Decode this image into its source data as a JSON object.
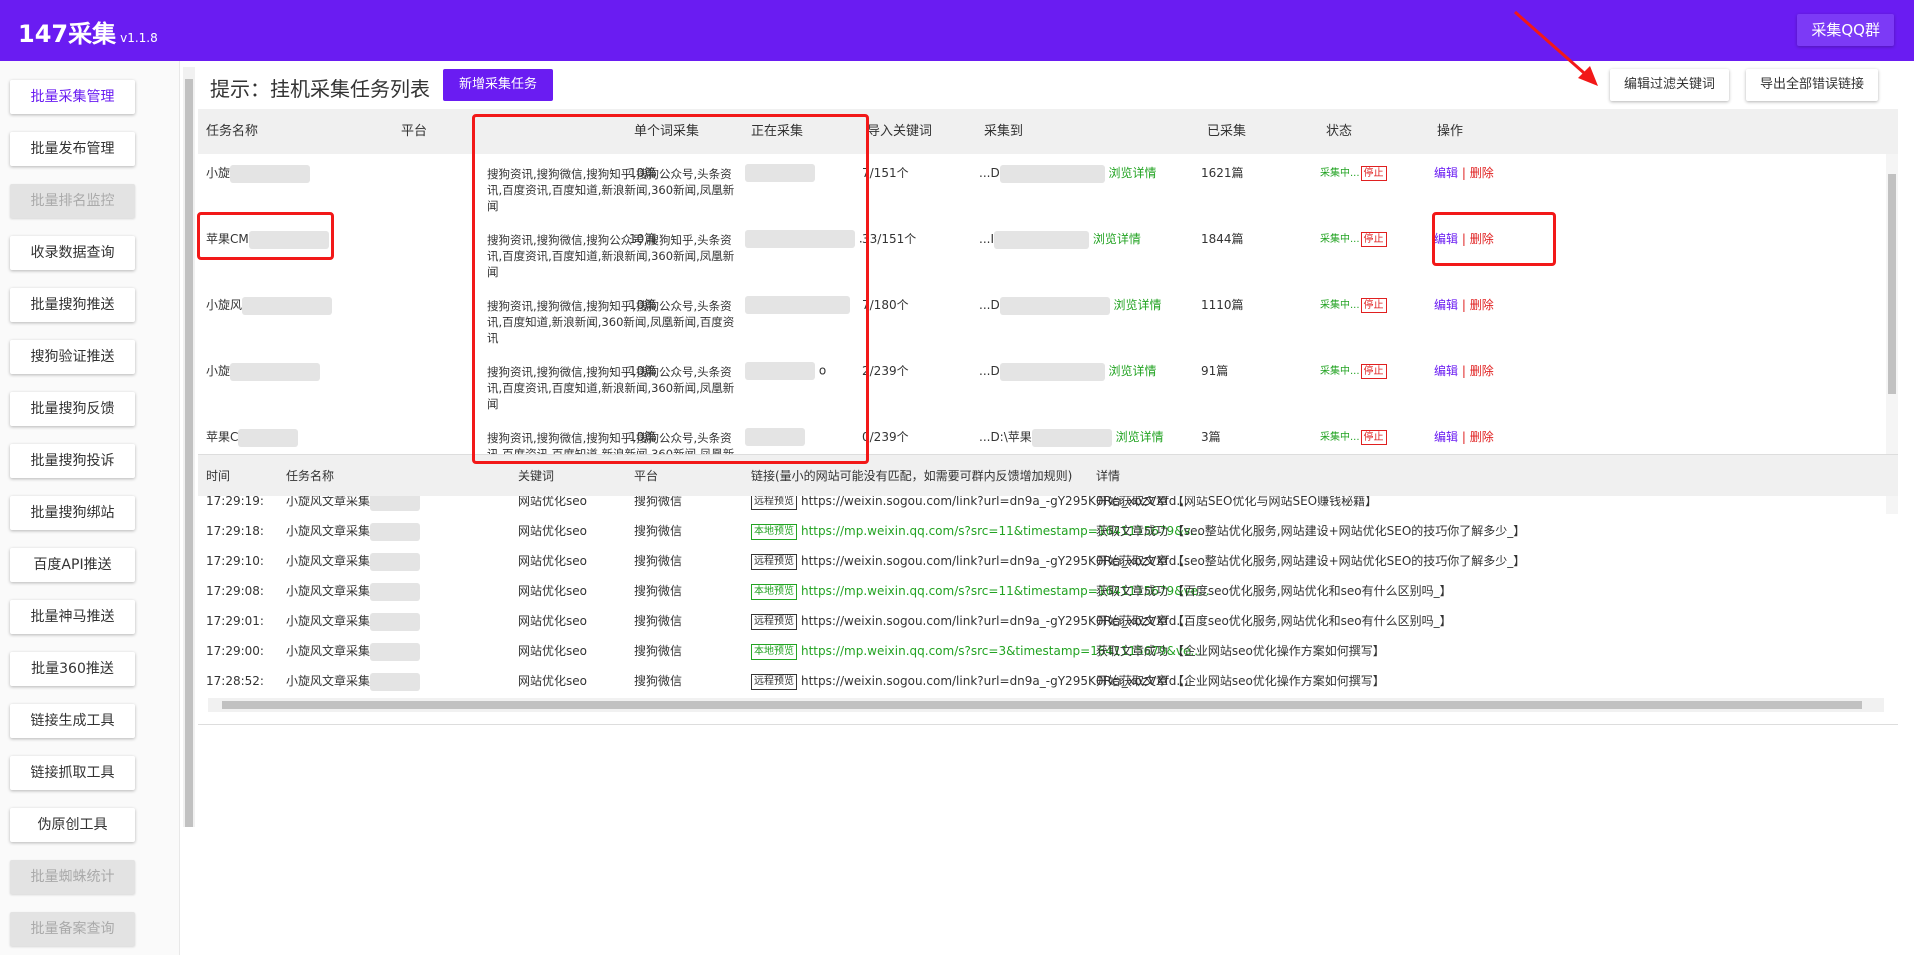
{
  "app": {
    "title": "147采集",
    "version": "v1.1.8",
    "qq_button": "采集QQ群"
  },
  "sidebar": {
    "items": [
      {
        "label": "批量采集管理",
        "state": "active"
      },
      {
        "label": "批量发布管理",
        "state": "normal"
      },
      {
        "label": "批量排名监控",
        "state": "disabled"
      },
      {
        "label": "收录数据查询",
        "state": "normal"
      },
      {
        "label": "批量搜狗推送",
        "state": "normal"
      },
      {
        "label": "搜狗验证推送",
        "state": "normal"
      },
      {
        "label": "批量搜狗反馈",
        "state": "normal"
      },
      {
        "label": "批量搜狗投诉",
        "state": "normal"
      },
      {
        "label": "批量搜狗绑站",
        "state": "normal"
      },
      {
        "label": "百度API推送",
        "state": "normal"
      },
      {
        "label": "批量神马推送",
        "state": "normal"
      },
      {
        "label": "批量360推送",
        "state": "normal"
      },
      {
        "label": "链接生成工具",
        "state": "normal"
      },
      {
        "label": "链接抓取工具",
        "state": "normal"
      },
      {
        "label": "伪原创工具",
        "state": "normal"
      },
      {
        "label": "批量蜘蛛统计",
        "state": "disabled"
      },
      {
        "label": "批量备案查询",
        "state": "disabled"
      }
    ]
  },
  "toolbar": {
    "hint": "提示：挂机采集任务列表",
    "new_task": "新增采集任务",
    "edit_filter": "编辑过滤关键词",
    "export_errors": "导出全部错误链接"
  },
  "task_table": {
    "columns": [
      "任务名称",
      "平台",
      "单个词采集",
      "正在采集",
      "导入关键词",
      "采集到",
      "已采集",
      "状态",
      "操作"
    ],
    "rows": [
      {
        "name": "小旋",
        "platforms": "搜狗资讯,搜狗微信,搜狗知乎,搜狗公众号,头条资讯,百度资讯,百度知道,新浪新闻,360新闻,凤凰新闻",
        "per_keyword": "10篇",
        "current": "",
        "keywords": "7/151个",
        "target": "...D",
        "detail": "浏览详情",
        "collected": "1621篇",
        "status": "采集中...",
        "stop": "停止",
        "edit": "编辑",
        "sep": "|",
        "delete": "删除"
      },
      {
        "name": "苹果CM",
        "platforms": "搜狗资讯,搜狗微信,搜狗公众号,搜狗知乎,头条资讯,百度资讯,百度知道,新浪新闻,360新闻,凤凰新闻",
        "per_keyword": "10篇",
        "current": ".",
        "keywords": "33/151个",
        "target": "...I",
        "detail": "浏览详情",
        "collected": "1844篇",
        "status": "采集中...",
        "stop": "停止",
        "edit": "编辑",
        "sep": "|",
        "delete": "删除"
      },
      {
        "name": "小旋风",
        "platforms": "搜狗资讯,搜狗微信,搜狗知乎,搜狗公众号,头条资讯,百度知道,新浪新闻,360新闻,凤凰新闻,百度资讯",
        "per_keyword": "10篇",
        "current": "",
        "keywords": "7/180个",
        "target": "...D",
        "detail": "浏览详情",
        "collected": "1110篇",
        "status": "采集中...",
        "stop": "停止",
        "edit": "编辑",
        "sep": "|",
        "delete": "删除"
      },
      {
        "name": "小旋",
        "platforms": "搜狗资讯,搜狗微信,搜狗知乎,搜狗公众号,头条资讯,百度资讯,百度知道,新浪新闻,360新闻,凤凰新闻",
        "per_keyword": "10篇",
        "current": "o",
        "keywords": "2/239个",
        "target": "...D",
        "detail": "浏览详情",
        "collected": "91篇",
        "status": "采集中...",
        "stop": "停止",
        "edit": "编辑",
        "sep": "|",
        "delete": "删除"
      },
      {
        "name": "苹果C",
        "platforms": "搜狗资讯,搜狗微信,搜狗知乎,搜狗公众号,头条资讯,百度资讯,百度知道,新浪新闻,360新闻,凤凰新闻",
        "per_keyword": "10篇",
        "current": "",
        "keywords": "0/239个",
        "target": "...D:\\苹果",
        "detail": "浏览详情",
        "collected": "3篇",
        "status": "采集中...",
        "stop": "停止",
        "edit": "编辑",
        "sep": "|",
        "delete": "删除"
      }
    ]
  },
  "log_table": {
    "columns": [
      "时间",
      "任务名称",
      "关键词",
      "平台",
      "链接(量小的网站可能没有匹配，如需要可群内反馈增加规则)",
      "详情"
    ],
    "rows": [
      {
        "time": "17:29:19:",
        "task": "小旋风文章采集",
        "keyword": "网站优化seo",
        "platform": "搜狗微信",
        "tag": "远程预览",
        "tag_type": "remote",
        "link": "https://weixin.sogou.com/link?url=dn9a_-gY295K0Rci_xozVXfd...",
        "detail": "开始获取文章 【网站SEO优化与网站SEO赚钱秘籍】"
      },
      {
        "time": "17:29:18:",
        "task": "小旋风文章采集",
        "keyword": "网站优化seo",
        "platform": "搜狗微信",
        "tag": "本地预览",
        "tag_type": "local",
        "link": "https://mp.weixin.qq.com/s?src=11&timestamp=1641115679&v...",
        "detail": "获取文章成功 【seo整站优化服务,网站建设+网站优化SEO的技巧你了解多少_】"
      },
      {
        "time": "17:29:10:",
        "task": "小旋风文章采集",
        "keyword": "网站优化seo",
        "platform": "搜狗微信",
        "tag": "远程预览",
        "tag_type": "remote",
        "link": "https://weixin.sogou.com/link?url=dn9a_-gY295K0Rci_xozVXfd...",
        "detail": "开始获取文章 【seo整站优化服务,网站建设+网站优化SEO的技巧你了解多少_】"
      },
      {
        "time": "17:29:08:",
        "task": "小旋风文章采集",
        "keyword": "网站优化seo",
        "platform": "搜狗微信",
        "tag": "本地预览",
        "tag_type": "local",
        "link": "https://mp.weixin.qq.com/s?src=11&timestamp=1641115679&ve...",
        "detail": "获取文章成功 【百度seo优化服务,网站优化和seo有什么区别吗_】"
      },
      {
        "time": "17:29:01:",
        "task": "小旋风文章采集",
        "keyword": "网站优化seo",
        "platform": "搜狗微信",
        "tag": "远程预览",
        "tag_type": "remote",
        "link": "https://weixin.sogou.com/link?url=dn9a_-gY295K0Rci_xozVXfd...",
        "detail": "开始获取文章 【百度seo优化服务,网站优化和seo有什么区别吗_】"
      },
      {
        "time": "17:29:00:",
        "task": "小旋风文章采集",
        "keyword": "网站优化seo",
        "platform": "搜狗微信",
        "tag": "本地预览",
        "tag_type": "local",
        "link": "https://mp.weixin.qq.com/s?src=3&timestamp=1641115679&ve...",
        "detail": "获取文章成功 【企业网站seo优化操作方案如何撰写】"
      },
      {
        "time": "17:28:52:",
        "task": "小旋风文章采集",
        "keyword": "网站优化seo",
        "platform": "搜狗微信",
        "tag": "远程预览",
        "tag_type": "remote",
        "link": "https://weixin.sogou.com/link?url=dn9a_-gY295K0Rci_xozVXfd...",
        "detail": "开始获取文章 【企业网站seo优化操作方案如何撰写】"
      }
    ]
  },
  "colors": {
    "brand": "#6a1cf2",
    "green": "#22a322",
    "red": "#e02020",
    "annotation": "#f21818"
  }
}
